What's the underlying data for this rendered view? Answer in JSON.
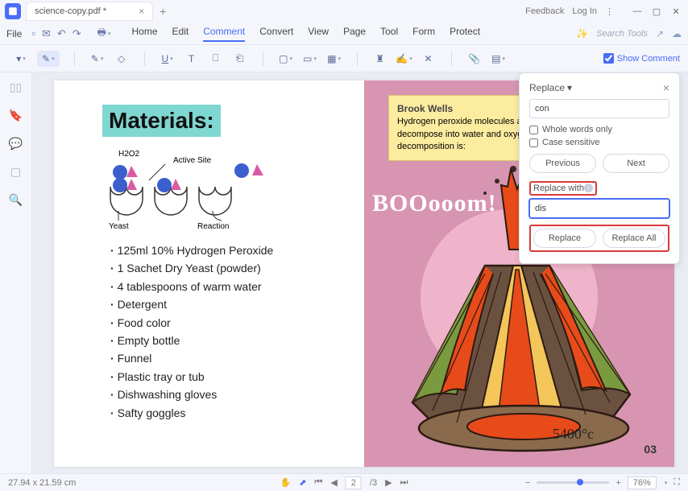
{
  "titlebar": {
    "tab_title": "science-copy.pdf *",
    "feedback": "Feedback",
    "login": "Log In"
  },
  "menubar": {
    "file": "File",
    "items": [
      "Home",
      "Edit",
      "Comment",
      "Convert",
      "View",
      "Page",
      "Tool",
      "Form",
      "Protect"
    ],
    "active_index": 2,
    "search_placeholder": "Search Tools"
  },
  "toolbar": {
    "show_comment": "Show Comment"
  },
  "document": {
    "materials_heading": "Materials:",
    "diagram_labels": {
      "h2o2": "H2O2",
      "active_site": "Active Site",
      "yeast": "Yeast",
      "reaction": "Reaction"
    },
    "materials": [
      "125ml 10% Hydrogen Peroxide",
      "1 Sachet Dry Yeast (powder)",
      "4 tablespoons of warm water",
      "Detergent",
      "Food color",
      "Empty bottle",
      "Funnel",
      "Plastic tray or tub",
      "Dishwashing gloves",
      "Safty goggles"
    ],
    "callout_name": "Brook Wells",
    "callout_text": "Hydrogen peroxide molecules are very unstable as they naturally decompose into water and oxygen. The chemical equation for this decomposition is:",
    "boom_text": "BOOooom!",
    "temperature": "5400°c",
    "page_number": "03"
  },
  "replace_panel": {
    "title": "Replace",
    "search_value": "con",
    "whole_words": "Whole words only",
    "case_sensitive": "Case sensitive",
    "previous": "Previous",
    "next": "Next",
    "replace_with_label": "Replace with",
    "replace_value": "dis",
    "replace": "Replace",
    "replace_all": "Replace All"
  },
  "statusbar": {
    "dimensions": "27.94 x 21.59 cm",
    "page_current": "2",
    "page_total": "/3",
    "zoom": "76%"
  }
}
